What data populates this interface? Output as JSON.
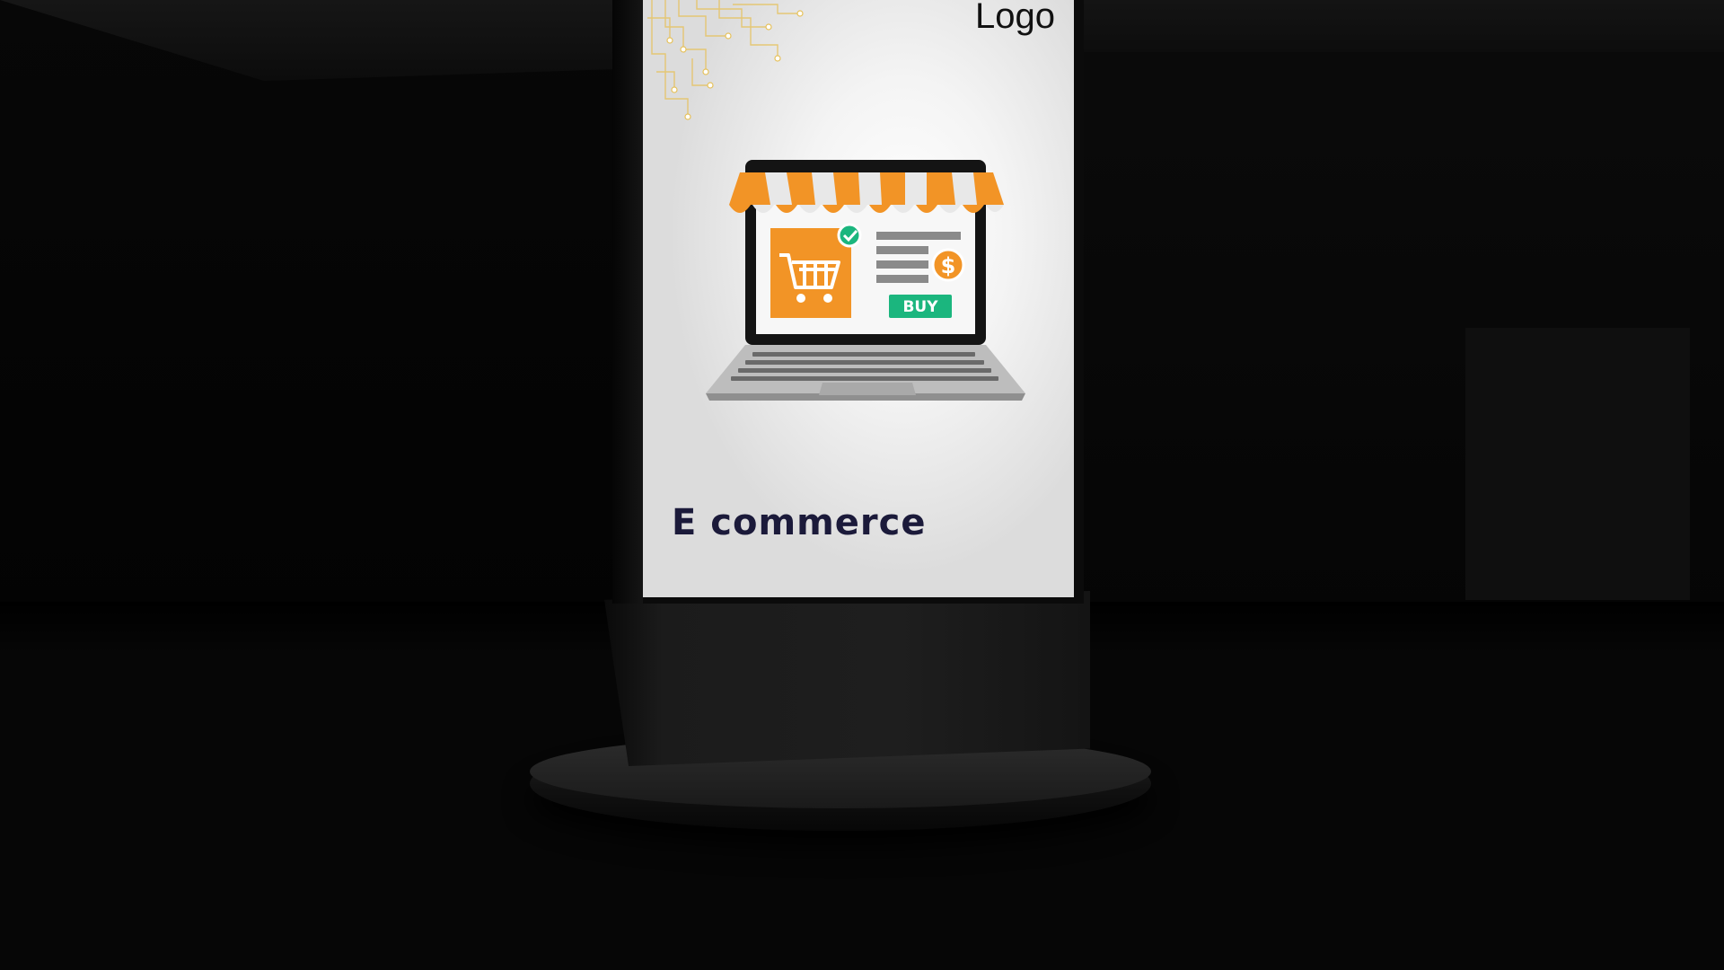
{
  "signage": {
    "logo_text": "Logo",
    "headline": "E commerce",
    "buy_label": "BUY",
    "currency_symbol": "$"
  },
  "colors": {
    "accent_orange": "#f29426",
    "buy_green": "#1bb67e",
    "headline_navy": "#1b1a3a",
    "circuit_gold": "#e6c15a"
  },
  "icons": [
    "shopping-cart-icon",
    "check-icon",
    "dollar-coin-icon",
    "laptop-icon",
    "awning-icon"
  ]
}
